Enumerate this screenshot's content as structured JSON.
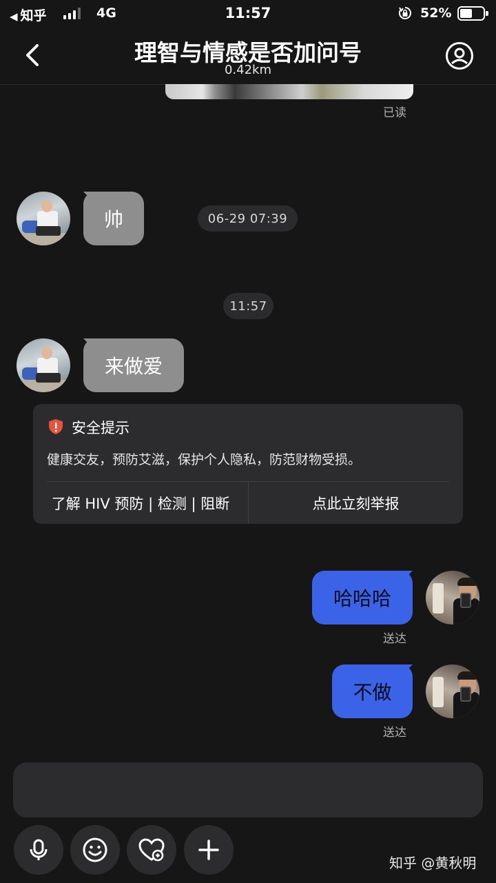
{
  "status_bar": {
    "back_app": "知乎",
    "network": "4G",
    "time": "11:57",
    "battery": "52%",
    "battery_level": 0.52
  },
  "header": {
    "title": "理智与情感是否加问号",
    "distance": "0.42km"
  },
  "messages": [
    {
      "id": "read",
      "text": "已读"
    },
    {
      "id": "m1",
      "from": "them",
      "text": "帅",
      "timestamp": "06-29 07:39"
    },
    {
      "id": "sep",
      "text": "11:57"
    },
    {
      "id": "m2",
      "from": "them",
      "text": "来做爱"
    },
    {
      "id": "m3",
      "from": "me",
      "text": "哈哈哈",
      "status": "送达"
    },
    {
      "id": "m4",
      "from": "me",
      "text": "不做",
      "status": "送达"
    }
  ],
  "safety_tip": {
    "title": "安全提示",
    "body": "健康交友，预防艾滋，保护个人隐私，防范财物受损。",
    "link_left": "了解 HIV 预防 | 检测 | 阻断",
    "link_right": "点此立刻举报"
  },
  "input": {
    "placeholder": ""
  },
  "toolbar": {
    "icons": [
      "microphone-icon",
      "emoji-icon",
      "heart-icon",
      "plus-icon"
    ]
  },
  "watermark": "知乎 @黄秋明",
  "colors": {
    "background": "#161617",
    "bubble_in": "#8e8e8e",
    "bubble_out": "#3a63e8",
    "card": "#2c2c2e",
    "shield": "#e5543d"
  }
}
